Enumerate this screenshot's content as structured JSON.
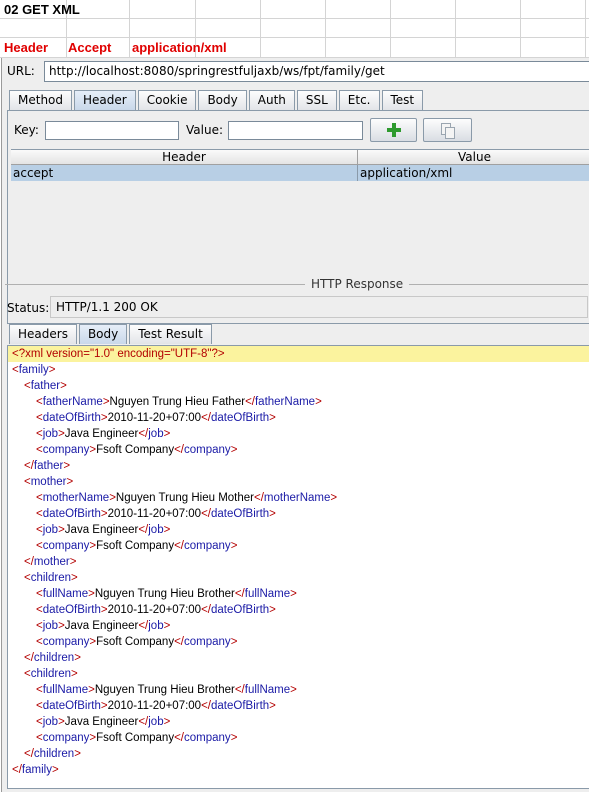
{
  "sheet": {
    "title": "02 GET XML",
    "row": [
      "Header",
      "Accept",
      "application/xml"
    ]
  },
  "request": {
    "url_label": "URL:",
    "url": "http://localhost:8080/springrestfuljaxb/ws/fpt/family/get",
    "tabs": [
      "Method",
      "Header",
      "Cookie",
      "Body",
      "Auth",
      "SSL",
      "Etc.",
      "Test"
    ],
    "active_tab": "Header",
    "key_label": "Key:",
    "value_label": "Value:",
    "key_value": "",
    "value_value": "",
    "table": {
      "columns": [
        "Header",
        "Value"
      ],
      "rows": [
        [
          "accept",
          "application/xml"
        ]
      ]
    }
  },
  "response": {
    "title": "HTTP Response",
    "status_label": "Status:",
    "status": "HTTP/1.1 200 OK",
    "tabs": [
      "Headers",
      "Body",
      "Test Result"
    ],
    "active_tab": "Body",
    "xml_lines": [
      {
        "indent": 0,
        "pi": "<?xml version=\"1.0\" encoding=\"UTF-8\"?>"
      },
      {
        "indent": 0,
        "open": "family"
      },
      {
        "indent": 1,
        "open": "father"
      },
      {
        "indent": 2,
        "tag": "fatherName",
        "text": "Nguyen Trung Hieu Father"
      },
      {
        "indent": 2,
        "tag": "dateOfBirth",
        "text": "2010-11-20+07:00"
      },
      {
        "indent": 2,
        "tag": "job",
        "text": "Java Engineer"
      },
      {
        "indent": 2,
        "tag": "company",
        "text": "Fsoft Company"
      },
      {
        "indent": 1,
        "close": "father"
      },
      {
        "indent": 1,
        "open": "mother"
      },
      {
        "indent": 2,
        "tag": "motherName",
        "text": "Nguyen Trung Hieu Mother"
      },
      {
        "indent": 2,
        "tag": "dateOfBirth",
        "text": "2010-11-20+07:00"
      },
      {
        "indent": 2,
        "tag": "job",
        "text": "Java Engineer"
      },
      {
        "indent": 2,
        "tag": "company",
        "text": "Fsoft Company"
      },
      {
        "indent": 1,
        "close": "mother"
      },
      {
        "indent": 1,
        "open": "children"
      },
      {
        "indent": 2,
        "tag": "fullName",
        "text": "Nguyen Trung Hieu Brother"
      },
      {
        "indent": 2,
        "tag": "dateOfBirth",
        "text": "2010-11-20+07:00"
      },
      {
        "indent": 2,
        "tag": "job",
        "text": "Java Engineer"
      },
      {
        "indent": 2,
        "tag": "company",
        "text": "Fsoft Company"
      },
      {
        "indent": 1,
        "close": "children"
      },
      {
        "indent": 1,
        "open": "children"
      },
      {
        "indent": 2,
        "tag": "fullName",
        "text": "Nguyen Trung Hieu Brother"
      },
      {
        "indent": 2,
        "tag": "dateOfBirth",
        "text": "2010-11-20+07:00"
      },
      {
        "indent": 2,
        "tag": "job",
        "text": "Java Engineer"
      },
      {
        "indent": 2,
        "tag": "company",
        "text": "Fsoft Company"
      },
      {
        "indent": 1,
        "close": "children"
      },
      {
        "indent": 0,
        "close": "family"
      }
    ]
  },
  "colors": {
    "header_red": "#e00000",
    "xml_tag": "#1a1aa6",
    "xml_bracket": "#b30000",
    "selected_row": "#b8cfe5",
    "pi_highlight": "#fbf39e"
  }
}
